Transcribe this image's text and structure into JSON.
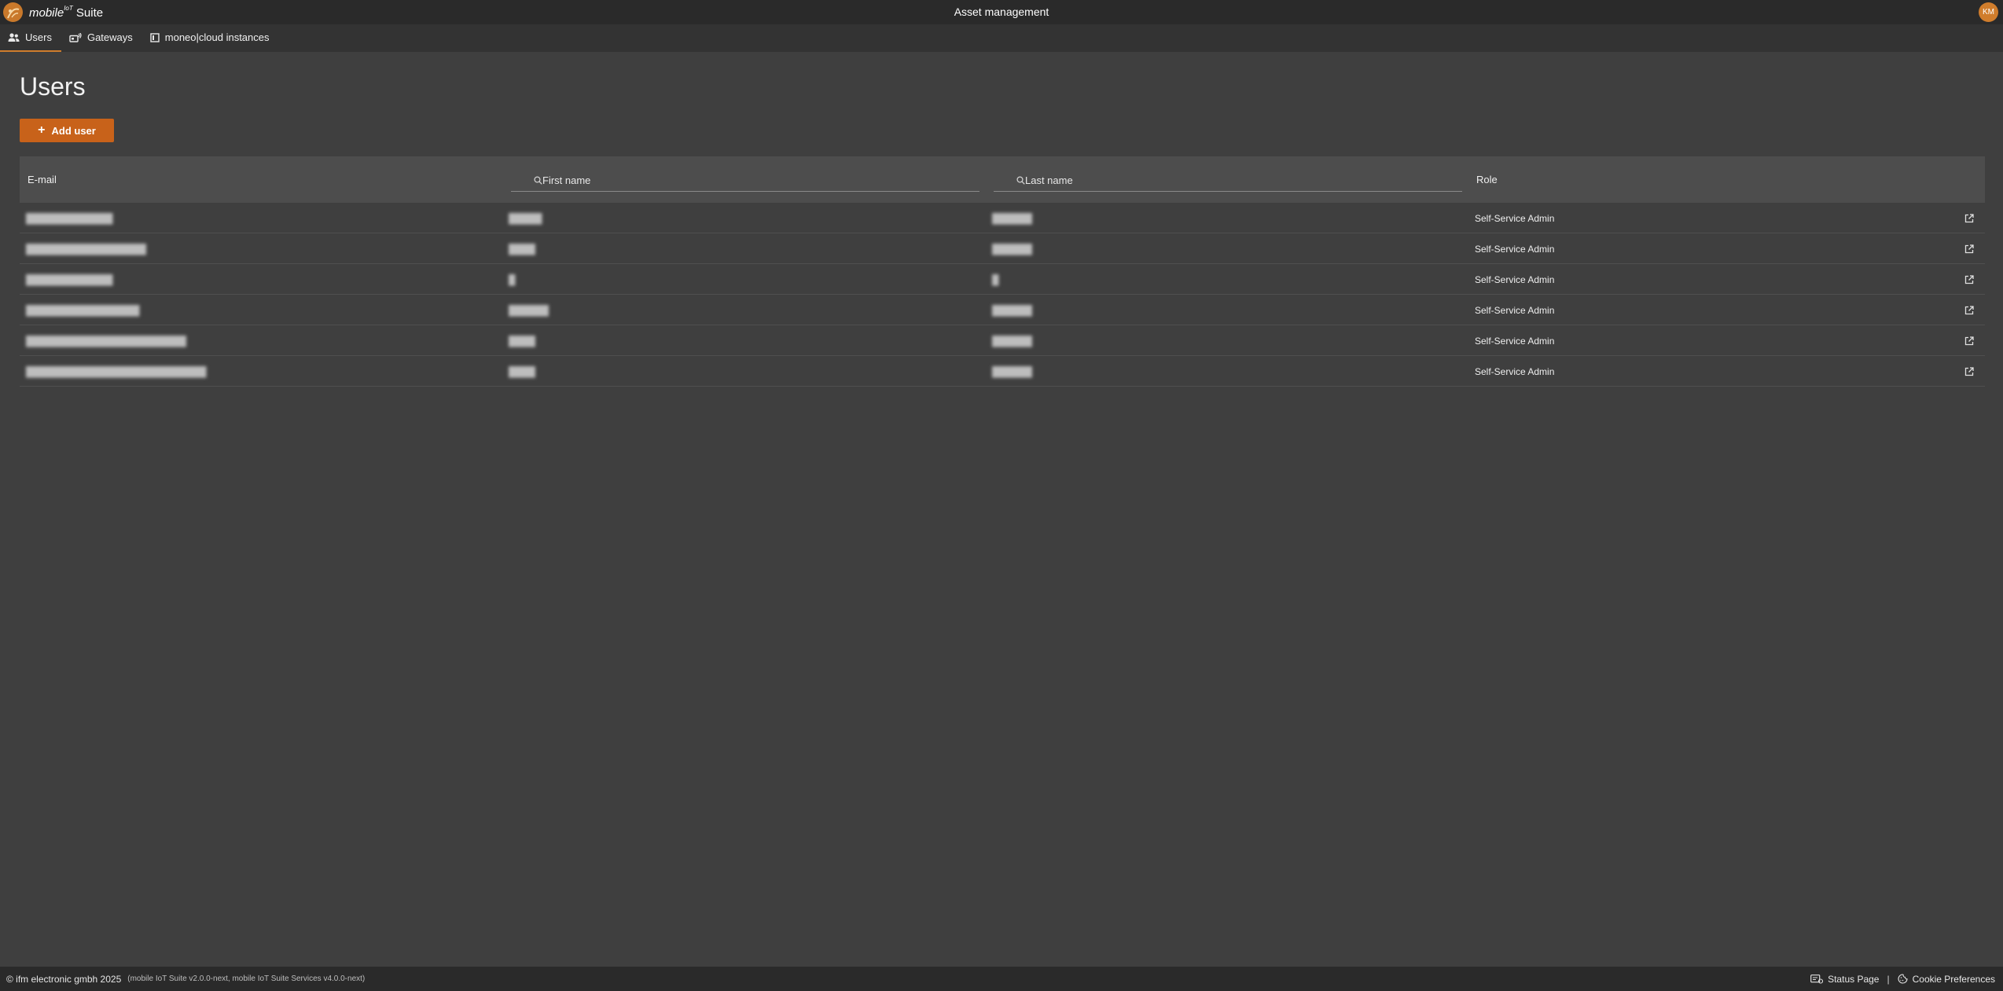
{
  "header": {
    "brand_prefix": "mobile",
    "brand_sup": "IoT",
    "brand_suffix": "Suite",
    "title": "Asset management",
    "avatar_initials": "KM"
  },
  "nav": {
    "tabs": [
      {
        "label": "Users",
        "icon": "users-icon",
        "active": true
      },
      {
        "label": "Gateways",
        "icon": "gateway-icon",
        "active": false
      },
      {
        "label": "moneo|cloud instances",
        "icon": "instance-icon",
        "active": false
      }
    ]
  },
  "main": {
    "title": "Users",
    "add_button_label": "Add user",
    "table": {
      "columns": {
        "email": "E-mail",
        "first_name_placeholder": "First name",
        "last_name_placeholder": "Last name",
        "role": "Role"
      },
      "rows": [
        {
          "email": "█████████████",
          "first": "█████",
          "last": "██████",
          "role": "Self-Service Admin"
        },
        {
          "email": "██████████████████",
          "first": "████",
          "last": "██████",
          "role": "Self-Service Admin"
        },
        {
          "email": "█████████████",
          "first": "█",
          "last": "█",
          "role": "Self-Service Admin"
        },
        {
          "email": "█████████████████",
          "first": "██████",
          "last": "██████",
          "role": "Self-Service Admin"
        },
        {
          "email": "████████████████████████",
          "first": "████",
          "last": "██████",
          "role": "Self-Service Admin"
        },
        {
          "email": "███████████████████████████",
          "first": "████",
          "last": "██████",
          "role": "Self-Service Admin"
        }
      ]
    }
  },
  "footer": {
    "copyright": "© ifm electronic gmbh 2025",
    "version": "(mobile IoT Suite v2.0.0-next, mobile IoT Suite Services v4.0.0-next)",
    "status_page": "Status Page",
    "separator": "|",
    "cookie_preferences": "Cookie Preferences"
  },
  "colors": {
    "accent": "#d07d2c",
    "button": "#c8621a",
    "background": "#3f3f3f",
    "topbar": "#2a2a2a"
  }
}
